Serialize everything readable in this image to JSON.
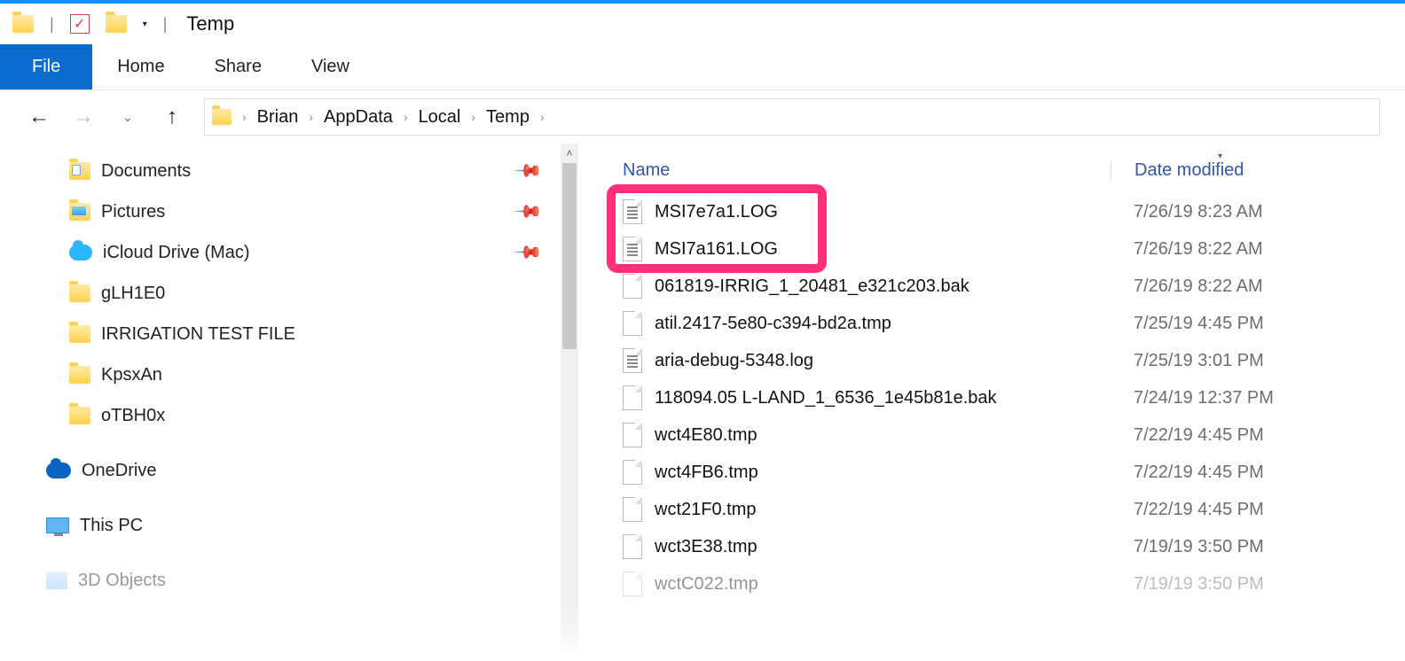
{
  "window": {
    "title": "Temp"
  },
  "ribbon": {
    "file": "File",
    "tabs": [
      "Home",
      "Share",
      "View"
    ]
  },
  "breadcrumb": [
    "Brian",
    "AppData",
    "Local",
    "Temp"
  ],
  "sidebar": {
    "items": [
      {
        "label": "Documents",
        "icon": "docs",
        "pinned": true
      },
      {
        "label": "Pictures",
        "icon": "pics",
        "pinned": true
      },
      {
        "label": "iCloud Drive (Mac)",
        "icon": "cloud",
        "pinned": true
      },
      {
        "label": "gLH1E0",
        "icon": "folder",
        "pinned": false
      },
      {
        "label": "IRRIGATION  TEST FILE",
        "icon": "folder",
        "pinned": false
      },
      {
        "label": "KpsxAn",
        "icon": "folder",
        "pinned": false
      },
      {
        "label": "oTBH0x",
        "icon": "folder",
        "pinned": false
      }
    ],
    "groups": [
      {
        "label": "OneDrive",
        "icon": "onedrive"
      },
      {
        "label": "This PC",
        "icon": "thispc"
      },
      {
        "label": "3D Objects",
        "icon": "3d",
        "dimmed": true
      }
    ]
  },
  "columns": {
    "name": "Name",
    "date": "Date modified"
  },
  "files": [
    {
      "name": "MSI7e7a1.LOG",
      "date": "7/26/19 8:23 AM",
      "icon": "text"
    },
    {
      "name": "MSI7a161.LOG",
      "date": "7/26/19 8:22 AM",
      "icon": "text"
    },
    {
      "name": "061819-IRRIG_1_20481_e321c203.bak",
      "date": "7/26/19 8:22 AM",
      "icon": "file"
    },
    {
      "name": "atil.2417-5e80-c394-bd2a.tmp",
      "date": "7/25/19 4:45 PM",
      "icon": "file"
    },
    {
      "name": "aria-debug-5348.log",
      "date": "7/25/19 3:01 PM",
      "icon": "text"
    },
    {
      "name": "118094.05 L-LAND_1_6536_1e45b81e.bak",
      "date": "7/24/19 12:37 PM",
      "icon": "file"
    },
    {
      "name": "wct4E80.tmp",
      "date": "7/22/19 4:45 PM",
      "icon": "file"
    },
    {
      "name": "wct4FB6.tmp",
      "date": "7/22/19 4:45 PM",
      "icon": "file"
    },
    {
      "name": "wct21F0.tmp",
      "date": "7/22/19 4:45 PM",
      "icon": "file"
    },
    {
      "name": "wct3E38.tmp",
      "date": "7/19/19 3:50 PM",
      "icon": "file"
    },
    {
      "name": "wctC022.tmp",
      "date": "7/19/19 3:50 PM",
      "icon": "file",
      "fade": true
    }
  ]
}
